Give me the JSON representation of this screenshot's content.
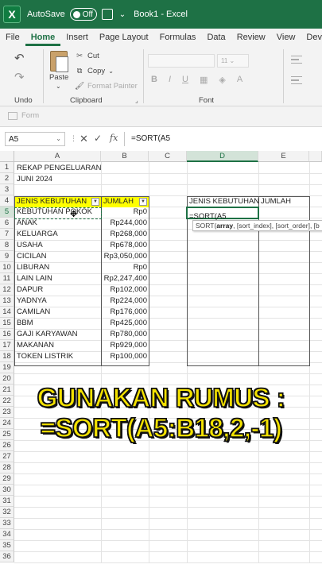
{
  "titlebar": {
    "autosave_label": "AutoSave",
    "toggle_state": "Off",
    "document_name": "Book1 - Excel"
  },
  "tabs": [
    "File",
    "Home",
    "Insert",
    "Page Layout",
    "Formulas",
    "Data",
    "Review",
    "View",
    "Develo"
  ],
  "active_tab": "Home",
  "ribbon": {
    "undo_label": "Undo",
    "clipboard_label": "Clipboard",
    "font_label": "Font",
    "paste_label": "Paste",
    "cut_label": "Cut",
    "copy_label": "Copy",
    "format_painter_label": "Format Painter",
    "font_size_value": "11",
    "bold": "B",
    "italic": "I",
    "underline": "U"
  },
  "form_button_label": "Form",
  "formula_bar": {
    "name_box": "A5",
    "formula": "=SORT(A5"
  },
  "columns": [
    "A",
    "B",
    "C",
    "D",
    "E"
  ],
  "rows": [
    "1",
    "2",
    "3",
    "4",
    "5",
    "6",
    "7",
    "8",
    "9",
    "10",
    "11",
    "12",
    "13",
    "14",
    "15",
    "16",
    "17",
    "18",
    "19",
    "20",
    "21",
    "22",
    "23",
    "24",
    "25",
    "26",
    "27",
    "28",
    "29",
    "30",
    "31",
    "32",
    "33",
    "34",
    "35",
    "36"
  ],
  "sheet": {
    "title1": "REKAP PENGELUARAN",
    "title2": "JUNI 2024",
    "header_a": "JENIS KEBUTUHAN",
    "header_b": "JUMLAH",
    "header_d": "JENIS KEBUTUHAN",
    "header_e": "JUMLAH",
    "d5_formula": "=SORT(A5",
    "table": [
      {
        "name": "KEBUTUHAN POKOK",
        "amount": "Rp0"
      },
      {
        "name": "ANAK",
        "amount": "Rp244,000"
      },
      {
        "name": "KELUARGA",
        "amount": "Rp268,000"
      },
      {
        "name": "USAHA",
        "amount": "Rp678,000"
      },
      {
        "name": "CICILAN",
        "amount": "Rp3,050,000"
      },
      {
        "name": "LIBURAN",
        "amount": "Rp0"
      },
      {
        "name": "LAIN LAIN",
        "amount": "Rp2,247,400"
      },
      {
        "name": "DAPUR",
        "amount": "Rp102,000"
      },
      {
        "name": "YADNYA",
        "amount": "Rp224,000"
      },
      {
        "name": "CAMILAN",
        "amount": "Rp176,000"
      },
      {
        "name": "BBM",
        "amount": "Rp425,000"
      },
      {
        "name": "GAJI KARYAWAN",
        "amount": "Rp780,000"
      },
      {
        "name": "MAKANAN",
        "amount": "Rp929,000"
      },
      {
        "name": "TOKEN LISTRIK",
        "amount": "Rp100,000"
      }
    ],
    "tooltip_fn": "SORT(",
    "tooltip_arg1": "array",
    "tooltip_rest": ", [sort_index], [sort_order], [b"
  },
  "caption": {
    "line1": "GUNAKAN RUMUS :",
    "line2": "=SORT(A5:B18,2,-1)"
  },
  "colors": {
    "excel_green": "#1e7145",
    "header_yellow": "#ffff00",
    "caption_yellow": "#f4e200"
  }
}
